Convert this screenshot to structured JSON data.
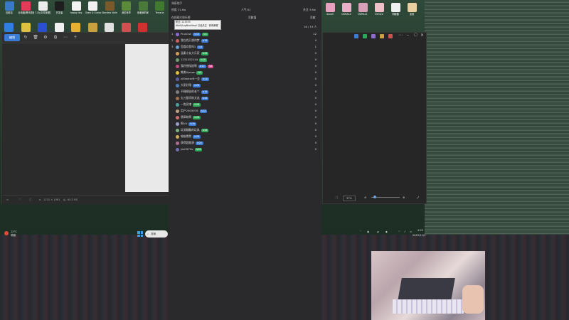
{
  "desktop_icons": [
    {
      "label": "回收站",
      "color": "#3a78c9"
    },
    {
      "label": "此电脑/腾讯视频",
      "color": "#e23b5a"
    },
    {
      "label": "7-Zip文件管理器",
      "color": "#ececec"
    },
    {
      "label": "开发者",
      "color": "#1e1e1e"
    },
    {
      "label": "happy day",
      "color": "#f2f2f2"
    },
    {
      "label": "Draw & Guess - 你...",
      "color": "#f2f2f2"
    },
    {
      "label": "Stardew Valley",
      "color": "#7a5a2a"
    },
    {
      "label": "我的世界",
      "color": "#5a8a3a"
    },
    {
      "label": "我爱我的家",
      "color": "#4a7a3a"
    },
    {
      "label": "Terraria",
      "color": "#3f7a2f"
    }
  ],
  "desktop_icons_row2": [
    {
      "color": "#2f7fe0"
    },
    {
      "color": "#e0c040"
    },
    {
      "color": "#2b4fd0"
    },
    {
      "color": "#f0f0f0"
    },
    {
      "color": "#e8b030"
    },
    {
      "color": "#c8a040"
    },
    {
      "color": "#e0e0e0"
    },
    {
      "color": "#d05050"
    },
    {
      "color": "#d03030"
    }
  ],
  "right_icons": [
    {
      "label": "donell",
      "color": "#e8a0c0"
    },
    {
      "label": "DORA10",
      "color": "#e8b0c8"
    },
    {
      "label": "DORA11",
      "color": "#d8a0b8"
    },
    {
      "label": "DOG22",
      "color": "#f0c0c8"
    },
    {
      "label": "伺服器",
      "color": "#f0f0f0"
    },
    {
      "label": "发烧",
      "color": "#e8d0a0"
    }
  ],
  "live_panel": {
    "title": "弹幕助手",
    "stats": {
      "viewers": "热度 21.6w",
      "popularity": "人气 61",
      "followers": "关注 3.6w"
    },
    "header_row": {
      "left": "在线观众排行榜",
      "middle": "贡献值",
      "right": "贡献"
    },
    "tooltip_line1": "粉丝: 213333",
    "tooltip_line2": "Wie0/LogNine9mpl 已经关注 · 获得荣耀",
    "online_count": "16 / 19 人",
    "rows": [
      {
        "rank": "1",
        "name": "PlusOuli",
        "badge": "lv13",
        "badge_color": "#3a7bd5",
        "extra": "lv1",
        "extra_color": "#2fa85a",
        "score": "12",
        "avatar": "#8e6bd0"
      },
      {
        "rank": "2",
        "name": "我在找只想的梦",
        "badge": "lv16",
        "badge_color": "#3a7bd5",
        "extra": "",
        "extra_color": "",
        "score": "4",
        "avatar": "#c86060"
      },
      {
        "rank": "3",
        "name": "您喜欢我吗2",
        "badge": "lv4",
        "badge_color": "#3a7bd5",
        "extra": "",
        "extra_color": "",
        "score": "1",
        "avatar": "#6aa0d0"
      },
      {
        "rank": "",
        "name": "温柔小女大乐家",
        "badge": "lv28",
        "badge_color": "#2fa85a",
        "extra": "",
        "extra_color": "",
        "score": "0",
        "avatar": "#d0a060"
      },
      {
        "rank": "",
        "name": "1231452144",
        "badge": "lv28",
        "badge_color": "#2fa85a",
        "extra": "",
        "extra_color": "",
        "score": "0",
        "avatar": "#70a070"
      },
      {
        "rank": "",
        "name": "我好想陪陪啊",
        "badge": "lv12",
        "badge_color": "#3a7bd5",
        "extra": "lv8",
        "extra_color": "#d04a8a",
        "score": "0",
        "avatar": "#c05080"
      },
      {
        "rank": "",
        "name": "美美Ujasan",
        "badge": "lv5",
        "badge_color": "#2fa85a",
        "extra": "",
        "extra_color": "",
        "score": "0",
        "avatar": "#e0c040"
      },
      {
        "rank": "",
        "name": "z09whzeR一会",
        "badge": "lv16",
        "badge_color": "#3a7bd5",
        "extra": "",
        "extra_color": "",
        "score": "0",
        "avatar": "#6060a0"
      },
      {
        "rank": "",
        "name": "大家好哦",
        "badge": "lv28",
        "badge_color": "#3a7bd5",
        "extra": "",
        "extra_color": "",
        "score": "0",
        "avatar": "#5080c0"
      },
      {
        "rank": "",
        "name": "不睡睡觉的老个",
        "badge": "lv16",
        "badge_color": "#3a7bd5",
        "extra": "",
        "extra_color": "",
        "score": "0",
        "avatar": "#808080"
      },
      {
        "rank": "",
        "name": "尖刀整司练文选",
        "badge": "lv28",
        "badge_color": "#3a7bd5",
        "extra": "",
        "extra_color": "",
        "score": "0",
        "avatar": "#a07050"
      },
      {
        "rank": "",
        "name": "一抱灵魂",
        "badge": "lv28",
        "badge_color": "#2fa85a",
        "extra": "",
        "extra_color": "",
        "score": "0",
        "avatar": "#50a0a0"
      },
      {
        "rank": "",
        "name": "用户2905976",
        "badge": "lv28",
        "badge_color": "#3a7bd5",
        "extra": "",
        "extra_color": "",
        "score": "0",
        "avatar": "#c0a080"
      },
      {
        "rank": "",
        "name": "翡翠粉啊",
        "badge": "lv28",
        "badge_color": "#2fa85a",
        "extra": "",
        "extra_color": "",
        "score": "0",
        "avatar": "#d07070"
      },
      {
        "rank": "",
        "name": "啊UU",
        "badge": "lv3a",
        "badge_color": "#3a7bd5",
        "extra": "",
        "extra_color": "",
        "score": "0",
        "avatar": "#a0a0d0"
      },
      {
        "rank": "",
        "name": "玩游翻翻的玩具",
        "badge": "lv28",
        "badge_color": "#2fa85a",
        "extra": "",
        "extra_color": "",
        "score": "0",
        "avatar": "#80b080"
      },
      {
        "rank": "",
        "name": "喵喵熊熊",
        "badge": "lv28",
        "badge_color": "#3a7bd5",
        "extra": "",
        "extra_color": "",
        "score": "0",
        "avatar": "#d0b060"
      },
      {
        "rank": "",
        "name": "获得超能源",
        "badge": "lv28",
        "badge_color": "#3a7bd5",
        "extra": "",
        "extra_color": "",
        "score": "0",
        "avatar": "#b07090"
      },
      {
        "rank": "",
        "name": "jwe9t79o",
        "badge": "lv28",
        "badge_color": "#2fa85a",
        "extra": "",
        "extra_color": "",
        "score": "0",
        "avatar": "#7070b0"
      }
    ]
  },
  "editor_window": {
    "active_tool": "编辑",
    "status_size": "1232 × 1961",
    "status_file": "64.3 KB"
  },
  "viewer_window": {
    "zoom": "57%"
  },
  "taskbar": {
    "weather_temp": "12°C",
    "weather_desc": "晴朗",
    "search_placeholder": "搜索",
    "time": "4:23",
    "date": "2025/11/3"
  }
}
